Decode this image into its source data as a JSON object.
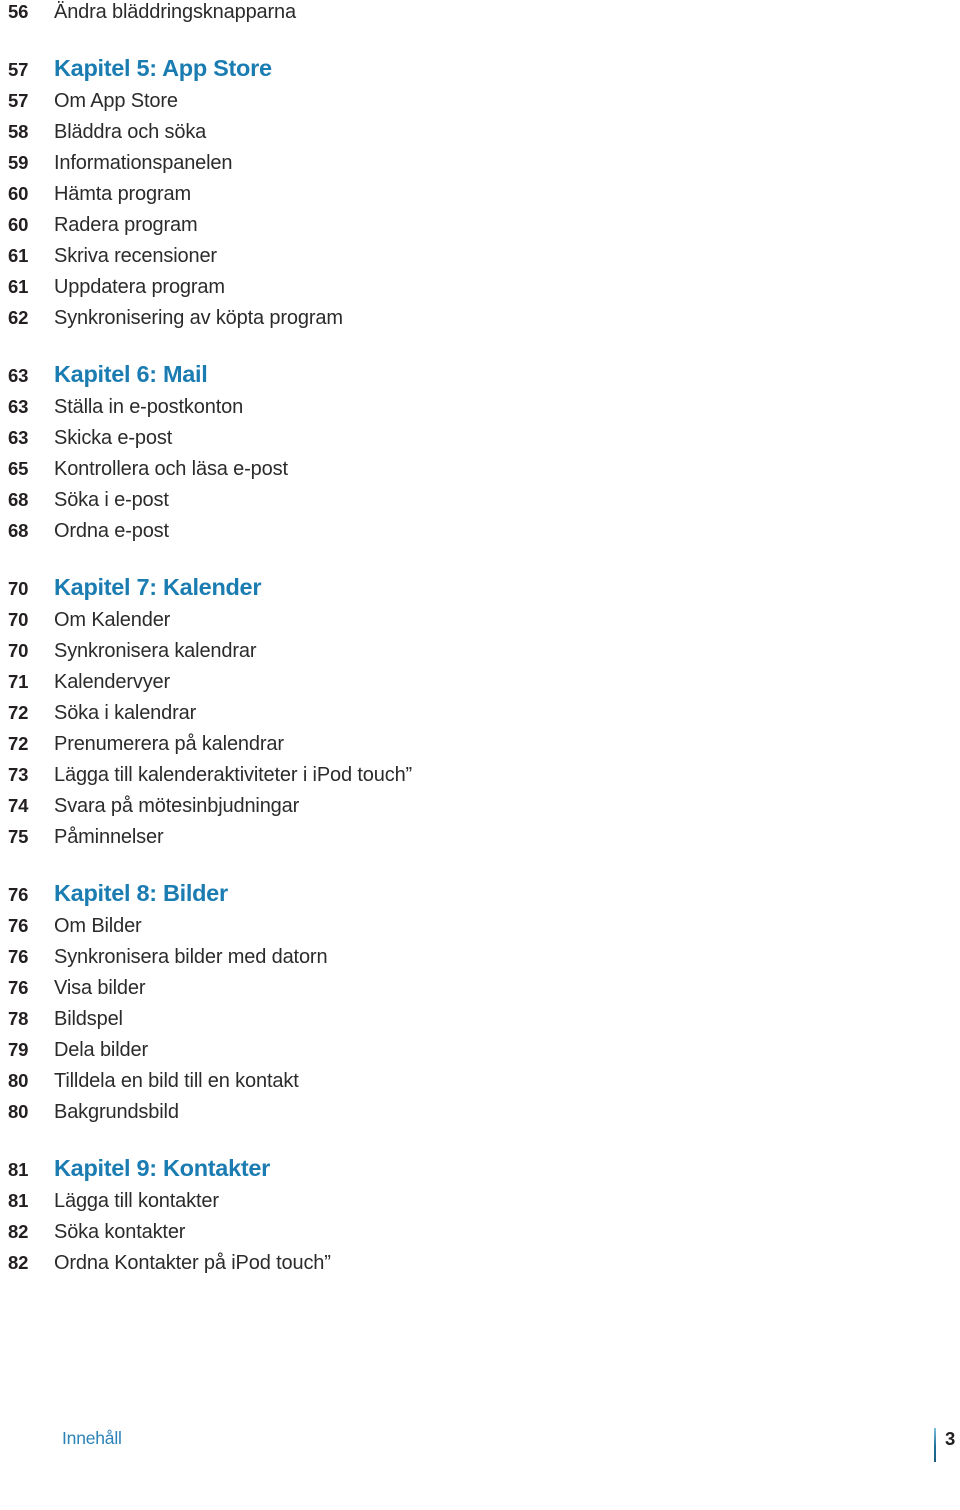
{
  "document": {
    "type": "table-of-contents",
    "language": "sv"
  },
  "colors": {
    "heading_blue": "#1b7cb2",
    "body_text": "#2b2b2b",
    "page_number": "#231f20",
    "footer_blue": "#2b82b8",
    "background": "#ffffff"
  },
  "toc": {
    "groups": [
      {
        "entries": [
          {
            "page": "56",
            "label": "Ändra bläddringsknapparna",
            "chapter": false
          }
        ]
      },
      {
        "entries": [
          {
            "page": "57",
            "label": "Kapitel 5: App Store",
            "chapter": true
          },
          {
            "page": "57",
            "label": "Om App Store",
            "chapter": false
          },
          {
            "page": "58",
            "label": "Bläddra och söka",
            "chapter": false
          },
          {
            "page": "59",
            "label": "Informationspanelen",
            "chapter": false
          },
          {
            "page": "60",
            "label": "Hämta program",
            "chapter": false
          },
          {
            "page": "60",
            "label": "Radera program",
            "chapter": false
          },
          {
            "page": "61",
            "label": "Skriva recensioner",
            "chapter": false
          },
          {
            "page": "61",
            "label": "Uppdatera program",
            "chapter": false
          },
          {
            "page": "62",
            "label": "Synkronisering av köpta program",
            "chapter": false
          }
        ]
      },
      {
        "entries": [
          {
            "page": "63",
            "label": "Kapitel 6: Mail",
            "chapter": true
          },
          {
            "page": "63",
            "label": "Ställa in e-postkonton",
            "chapter": false
          },
          {
            "page": "63",
            "label": "Skicka e-post",
            "chapter": false
          },
          {
            "page": "65",
            "label": "Kontrollera och läsa e-post",
            "chapter": false
          },
          {
            "page": "68",
            "label": "Söka i e-post",
            "chapter": false
          },
          {
            "page": "68",
            "label": "Ordna e-post",
            "chapter": false
          }
        ]
      },
      {
        "entries": [
          {
            "page": "70",
            "label": "Kapitel 7: Kalender",
            "chapter": true
          },
          {
            "page": "70",
            "label": "Om Kalender",
            "chapter": false
          },
          {
            "page": "70",
            "label": "Synkronisera kalendrar",
            "chapter": false
          },
          {
            "page": "71",
            "label": "Kalendervyer",
            "chapter": false
          },
          {
            "page": "72",
            "label": "Söka i kalendrar",
            "chapter": false
          },
          {
            "page": "72",
            "label": "Prenumerera på kalendrar",
            "chapter": false
          },
          {
            "page": "73",
            "label": "Lägga till kalenderaktiviteter i iPod touch”",
            "chapter": false
          },
          {
            "page": "74",
            "label": "Svara på mötesinbjudningar",
            "chapter": false
          },
          {
            "page": "75",
            "label": "Påminnelser",
            "chapter": false
          }
        ]
      },
      {
        "entries": [
          {
            "page": "76",
            "label": "Kapitel 8: Bilder",
            "chapter": true
          },
          {
            "page": "76",
            "label": "Om Bilder",
            "chapter": false
          },
          {
            "page": "76",
            "label": "Synkronisera bilder med datorn",
            "chapter": false
          },
          {
            "page": "76",
            "label": "Visa bilder",
            "chapter": false
          },
          {
            "page": "78",
            "label": "Bildspel",
            "chapter": false
          },
          {
            "page": "79",
            "label": "Dela bilder",
            "chapter": false
          },
          {
            "page": "80",
            "label": "Tilldela en bild till en kontakt",
            "chapter": false
          },
          {
            "page": "80",
            "label": "Bakgrundsbild",
            "chapter": false
          }
        ]
      },
      {
        "entries": [
          {
            "page": "81",
            "label": "Kapitel 9: Kontakter",
            "chapter": true
          },
          {
            "page": "81",
            "label": "Lägga till kontakter",
            "chapter": false
          },
          {
            "page": "82",
            "label": "Söka kontakter",
            "chapter": false
          },
          {
            "page": "82",
            "label": "Ordna Kontakter på iPod touch”",
            "chapter": false
          }
        ]
      }
    ]
  },
  "footer": {
    "title": "Innehåll",
    "page_number": "3"
  }
}
